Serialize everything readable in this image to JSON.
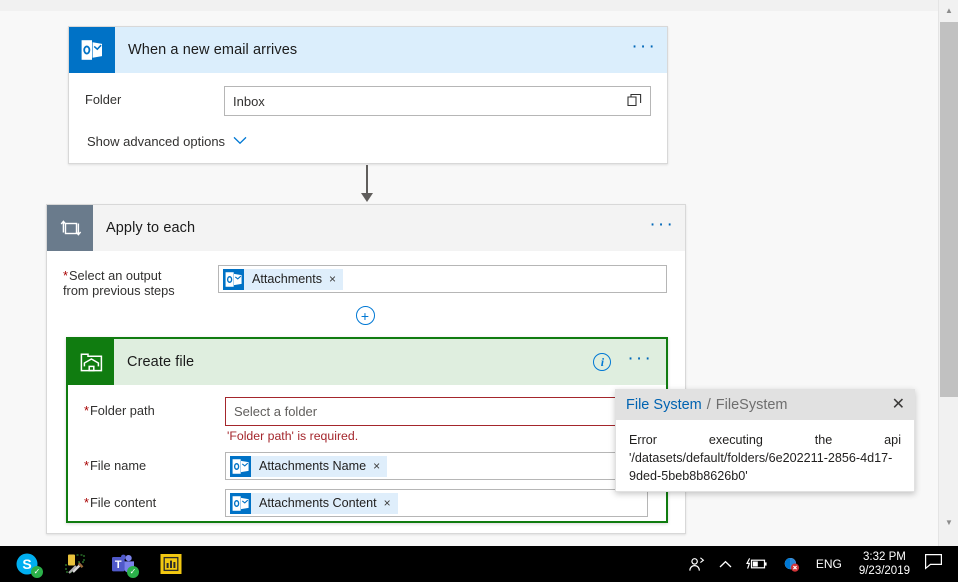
{
  "flow": {
    "trigger": {
      "title": "When a new email arrives",
      "icon": "outlook-icon",
      "menu_label": "···",
      "fields": [
        {
          "label": "Folder",
          "required": false,
          "value": "Inbox",
          "trailing_icon": "folder-picker-icon"
        }
      ],
      "advanced_label": "Show advanced options",
      "advanced_chevron": "chevron-down-icon"
    },
    "loop": {
      "title": "Apply to each",
      "icon": "loop-icon",
      "menu_label": "···",
      "select_output_label_line1": "Select an output",
      "select_output_label_line2": "from previous steps",
      "required_marker": "*",
      "token": {
        "label": "Attachments",
        "remove_label": "×",
        "icon": "outlook-icon"
      },
      "add_button_label": "+"
    },
    "create_file": {
      "title": "Create file",
      "icon": "filesystem-icon",
      "info_label": "i",
      "menu_label": "···",
      "folder_path": {
        "label": "Folder path",
        "required_marker": "*",
        "placeholder": "Select a folder",
        "error": "'Folder path' is required."
      },
      "file_name": {
        "label": "File name",
        "required_marker": "*",
        "token": {
          "label": "Attachments Name",
          "remove_label": "×",
          "icon": "outlook-icon"
        }
      },
      "file_content": {
        "label": "File content",
        "required_marker": "*",
        "token": {
          "label": "Attachments Content",
          "remove_label": "×",
          "icon": "outlook-icon"
        }
      }
    }
  },
  "error_flyout": {
    "title": "File System",
    "separator": "/",
    "subtitle": "FileSystem",
    "close_label": "✕",
    "message_line1": "Error executing the api",
    "message_line2": "'/datasets/default/folders/6e202211-2856-4d17-",
    "message_line3": "9ded-5beb8b8626b0'"
  },
  "scrollbar": {
    "up_arrow": "▲",
    "down_arrow": "▼"
  },
  "taskbar": {
    "apps": [
      {
        "name": "skype-taskbar-icon",
        "label": "Skype",
        "badge": "✓"
      },
      {
        "name": "build-tools-taskbar-icon",
        "label": "Build Tools",
        "badge": ""
      },
      {
        "name": "teams-taskbar-icon",
        "label": "Microsoft Teams",
        "badge": "✓"
      },
      {
        "name": "powerbi-taskbar-icon",
        "label": "Power BI",
        "badge": ""
      }
    ],
    "tray": {
      "people_icon": "people-icon",
      "show_hidden_icon": "chevron-up-icon",
      "battery_icon": "battery-charging-icon",
      "network_icon": "network-error-icon",
      "language": "ENG",
      "time": "3:32 PM",
      "date": "9/23/2019",
      "notifications_icon": "speech-bubble-icon"
    }
  },
  "colors": {
    "outlook_blue": "#0072C6",
    "green_accent": "#107C10",
    "loop_gray": "#6A7B8C",
    "error_red": "#A4262C",
    "link_blue": "#0078D4",
    "token_bg": "#DFEEFB"
  }
}
